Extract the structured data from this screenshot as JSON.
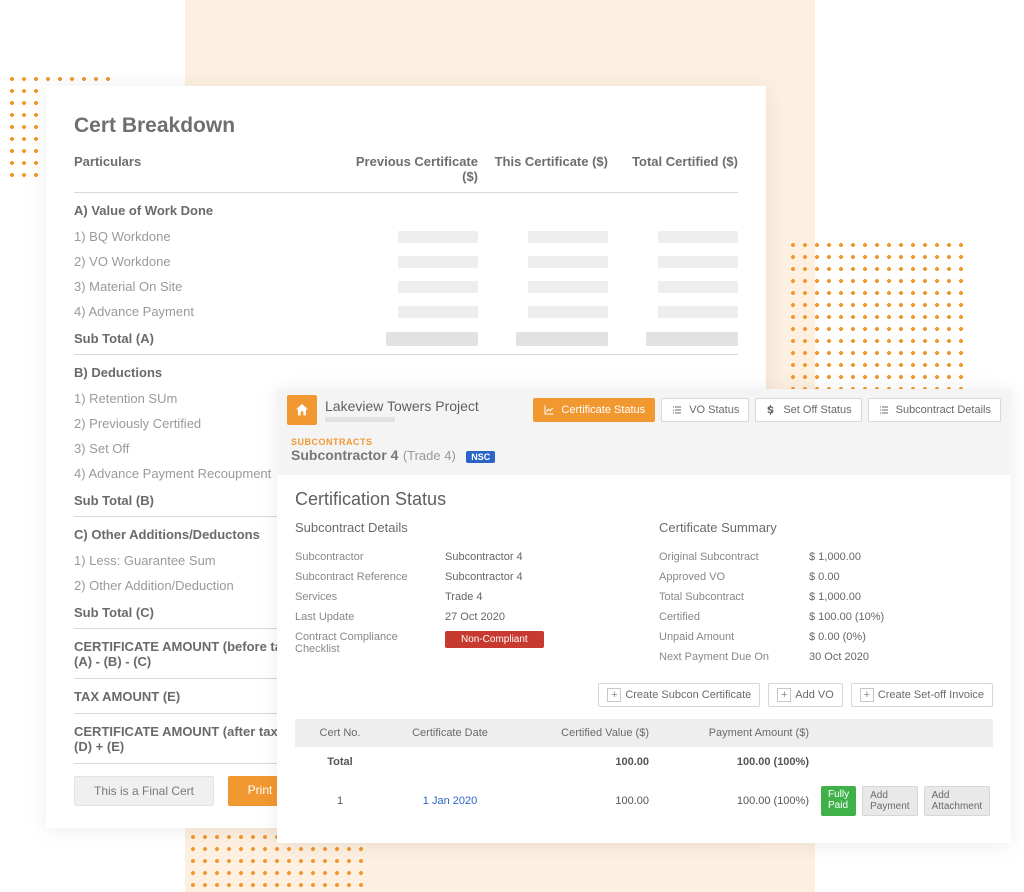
{
  "breakdown": {
    "title": "Cert Breakdown",
    "col_particulars": "Particulars",
    "col_prev": "Previous Certificate ($)",
    "col_this": "This Certificate ($)",
    "col_total": "Total Certified ($)",
    "secA": "A) Value of Work Done",
    "a1": "1) BQ Workdone",
    "a2": "2) VO Workdone",
    "a3": "3) Material On Site",
    "a4": "4) Advance Payment",
    "subA": "Sub Total (A)",
    "secB": "B) Deductions",
    "b1": "1) Retention SUm",
    "b2": "2) Previously Certified",
    "b3": "3) Set Off",
    "b4": "4) Advance Payment Recoupment",
    "subB": "Sub Total (B)",
    "secC": "C) Other Additions/Deductons",
    "c1": "1) Less: Guarantee Sum",
    "c2": "2) Other Addition/Deduction",
    "subC": "Sub Total (C)",
    "line_d": "CERTIFICATE AMOUNT (before tax) (D)\n(A) - (B) - (C)",
    "line_e": "TAX AMOUNT (E)",
    "line_f": "CERTIFICATE AMOUNT (after tax) (F)\n(D) + (E)",
    "btn_final": "This is a Final Cert",
    "btn_print": "Print"
  },
  "status": {
    "project": "Lakeview Towers Project",
    "tab_cert": "Certificate Status",
    "tab_vo": "VO Status",
    "tab_setoff": "Set Off Status",
    "tab_sub": "Subcontract Details",
    "bc": "SUBCONTRACTS",
    "subname": "Subcontractor 4",
    "trade": "(Trade 4)",
    "nsc": "NSC",
    "heading": "Certification Status",
    "details_h": "Subcontract Details",
    "summary_h": "Certificate Summary",
    "details": {
      "k_sub": "Subcontractor",
      "v_sub": "Subcontractor 4",
      "k_ref": "Subcontract Reference",
      "v_ref": "Subcontractor 4",
      "k_srv": "Services",
      "v_srv": "Trade 4",
      "k_upd": "Last Update",
      "v_upd": "27 Oct 2020",
      "k_ccc": "Contract Compliance Checklist",
      "v_ccc": "Non-Compliant"
    },
    "summary": {
      "k_orig": "Original Subcontract",
      "v_orig": "$ 1,000.00",
      "k_vo": "Approved VO",
      "v_vo": "$ 0.00",
      "k_tot": "Total Subcontract",
      "v_tot": "$ 1,000.00",
      "k_cert": "Certified",
      "v_cert": "$ 100.00 (10%)",
      "k_un": "Unpaid Amount",
      "v_un": "$ 0.00 (0%)",
      "k_next": "Next Payment Due On",
      "v_next": "30 Oct 2020"
    },
    "actions": {
      "create_cert": "Create Subcon Certificate",
      "add_vo": "Add VO",
      "create_setoff": "Create Set-off Invoice"
    },
    "table": {
      "h_no": "Cert No.",
      "h_date": "Certificate Date",
      "h_val": "Certified Value ($)",
      "h_pay": "Payment Amount ($)",
      "total_label": "Total",
      "total_val": "100.00",
      "total_pay": "100.00 (100%)",
      "r1_no": "1",
      "r1_date": "1 Jan 2020",
      "r1_val": "100.00",
      "r1_pay": "100.00 (100%)",
      "badge_paid": "Fully Paid",
      "btn_addpay": "Add Payment",
      "btn_addatt": "Add Attachment"
    }
  }
}
